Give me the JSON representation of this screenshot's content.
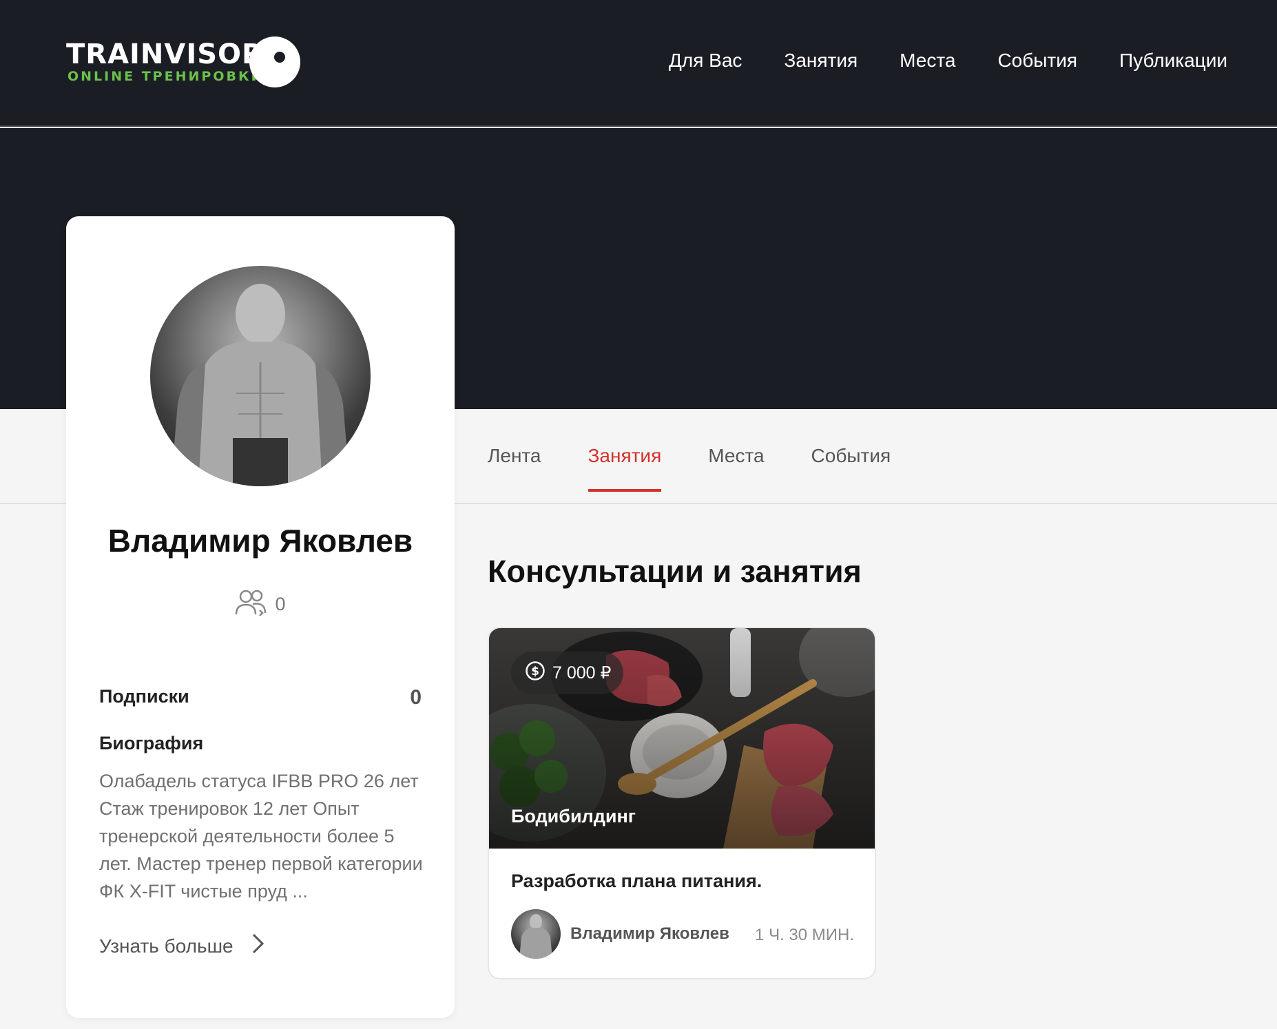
{
  "header": {
    "logo_title": "TRAINVISOR",
    "logo_subtitle": "ONLINE ТРЕНИРОВКИ",
    "nav": [
      "Для Вас",
      "Занятия",
      "Места",
      "События",
      "Публикации"
    ]
  },
  "profile": {
    "name": "Владимир Яковлев",
    "followers_count": "0",
    "subscriptions_label": "Подписки",
    "subscriptions_count": "0",
    "bio_title": "Биография",
    "bio_text": "Олабадель статуса IFBB PRO 26 лет Стаж тренировок 12 лет Опыт тренерской деятельности более 5 лет. Мастер тренер первой категории ФК X-FIT чистые пруд ...",
    "more_label": "Узнать больше"
  },
  "tabs": [
    {
      "label": "Лента",
      "active": false
    },
    {
      "label": "Занятия",
      "active": true
    },
    {
      "label": "Места",
      "active": false
    },
    {
      "label": "События",
      "active": false
    }
  ],
  "section_title": "Консультации и занятия",
  "card": {
    "price": "7 000 ₽",
    "category": "Бодибилдинг",
    "title": "Разработка плана питания.",
    "author": "Владимир Яковлев",
    "duration": "1 Ч. 30 МИН."
  },
  "colors": {
    "header_bg": "#1b1d25",
    "accent_red": "#d4322a",
    "logo_green": "#6cc04a"
  }
}
